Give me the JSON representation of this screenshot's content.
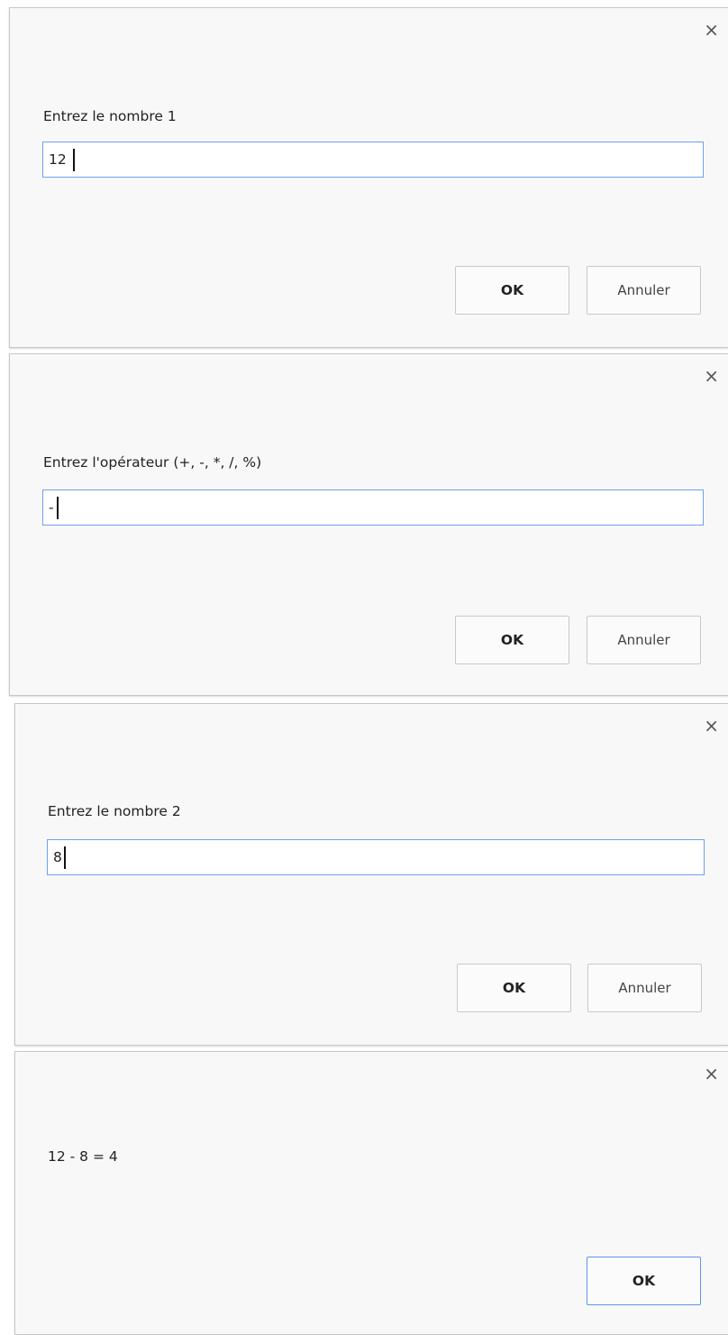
{
  "dialogs": [
    {
      "message": "Entrez le nombre 1",
      "input_value": "12",
      "ok_label": "OK",
      "cancel_label": "Annuler",
      "close_glyph": "×"
    },
    {
      "message": "Entrez l'opérateur (+, -, *, /, %)",
      "input_value": "-",
      "ok_label": "OK",
      "cancel_label": "Annuler",
      "close_glyph": "×"
    },
    {
      "message": "Entrez le nombre 2",
      "input_value": "8",
      "ok_label": "OK",
      "cancel_label": "Annuler",
      "close_glyph": "×"
    },
    {
      "message": "12 - 8 = 4",
      "ok_label": "OK",
      "close_glyph": "×"
    }
  ],
  "colors": {
    "dialog_background": "#f8f8f8",
    "focus_border": "#6fa0ef"
  },
  "icons": {
    "close": "close-icon"
  }
}
